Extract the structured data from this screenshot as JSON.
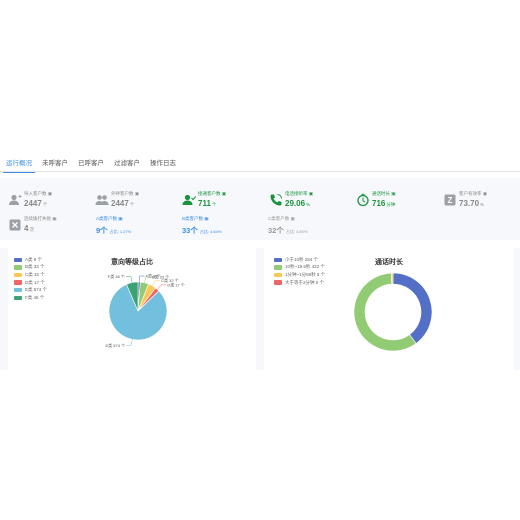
{
  "tabs": [
    "运行概况",
    "未呼客户",
    "已呼客户",
    "过滤客户",
    "操作日志"
  ],
  "stats_row1": [
    {
      "label": "导入客户数",
      "value": "2447",
      "unit": "个",
      "green": false
    },
    {
      "label": "外呼客户数",
      "value": "2447",
      "unit": "个",
      "green": false
    },
    {
      "label": "接通客户数",
      "value": "711",
      "unit": "个",
      "green": true
    },
    {
      "label": "电话接听率",
      "value": "29.06",
      "unit": "%",
      "green": true
    },
    {
      "label": "通话时长",
      "value": "716",
      "unit": "分钟",
      "green": true
    },
    {
      "label": "客户有效率",
      "value": "73.70",
      "unit": "%",
      "green": false
    }
  ],
  "stats_row2": [
    {
      "label": "连续拨打失败",
      "value": "4",
      "unit": "次",
      "sub": ""
    },
    {
      "label": "A类客户数",
      "value": "9个",
      "unit": "",
      "sub": "占比: 1.27%"
    },
    {
      "label": "B类客户数",
      "value": "33个",
      "unit": "",
      "sub": "占比: 4.64%"
    },
    {
      "label": "C类客户数",
      "value": "32个",
      "unit": "",
      "sub": "占比: 4.50%"
    }
  ],
  "colors": {
    "accent": "#3a8ee6",
    "green": "#17933c"
  },
  "chart_data": [
    {
      "type": "pie",
      "title": "意向等级占比",
      "categories": [
        "A类",
        "B类",
        "C类",
        "D类",
        "E类",
        "F类"
      ],
      "values": [
        9,
        33,
        32,
        17,
        574,
        46
      ],
      "unit": "个",
      "colors": [
        "#5470c6",
        "#91cc75",
        "#fac858",
        "#ee6666",
        "#73c0de",
        "#3ba272"
      ],
      "legend_position": "top-left"
    },
    {
      "type": "pie",
      "title": "通话时长",
      "categories": [
        "小于10秒",
        "10秒~19.5秒",
        "1分钟~1分59秒",
        "大于等于2分钟"
      ],
      "values": [
        284,
        422,
        5,
        0
      ],
      "unit": "个",
      "colors": [
        "#5470c6",
        "#91cc75",
        "#fac858",
        "#ee6666"
      ],
      "donut": true,
      "legend_position": "top-left"
    }
  ]
}
